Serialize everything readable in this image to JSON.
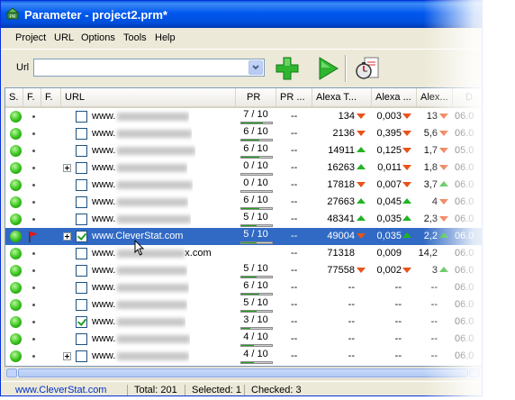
{
  "window": {
    "title": "Parameter - project2.prm*"
  },
  "menu": [
    "Project",
    "URL",
    "Options",
    "Tools",
    "Help"
  ],
  "toolbar": {
    "url_label": "Url",
    "url_value": "",
    "add_tooltip": "add-url",
    "run_tooltip": "run-check",
    "stats_tooltip": "statistics"
  },
  "columns": [
    "S.",
    "F.",
    "F.",
    "URL",
    "PR",
    "PR ...",
    "Alexa T...",
    "Alexa ...",
    "Alex...",
    "D"
  ],
  "rows": [
    {
      "url": "www.",
      "expand": false,
      "checked": false,
      "pr": "7 / 10",
      "prv": 0.7,
      "prdots": "--",
      "alexa": "134",
      "a_dir": "down",
      "alexa2": "0,003",
      "a2_dir": "down",
      "alexa3": "13",
      "a3_dir": "down",
      "date": "06.0"
    },
    {
      "url": "www.",
      "expand": false,
      "checked": false,
      "pr": "6 / 10",
      "prv": 0.6,
      "prdots": "--",
      "alexa": "2136",
      "a_dir": "down",
      "alexa2": "0,395",
      "a2_dir": "down",
      "alexa3": "5,6",
      "a3_dir": "down",
      "date": "06.0"
    },
    {
      "url": "www.",
      "expand": false,
      "checked": false,
      "pr": "6 / 10",
      "prv": 0.6,
      "prdots": "--",
      "alexa": "14911",
      "a_dir": "up",
      "alexa2": "0,125",
      "a2_dir": "down",
      "alexa3": "1,7",
      "a3_dir": "down",
      "date": "05.0"
    },
    {
      "url": "www.",
      "expand": true,
      "checked": false,
      "pr": "0 / 10",
      "prv": 0.0,
      "prdots": "--",
      "alexa": "16263",
      "a_dir": "up",
      "alexa2": "0,011",
      "a2_dir": "down",
      "alexa3": "1,8",
      "a3_dir": "down",
      "date": "06.0"
    },
    {
      "url": "www.",
      "expand": false,
      "checked": false,
      "pr": "0 / 10",
      "prv": 0.0,
      "prdots": "--",
      "alexa": "17818",
      "a_dir": "down",
      "alexa2": "0,007",
      "a2_dir": "down",
      "alexa3": "3,7",
      "a3_dir": "up",
      "date": "06.0"
    },
    {
      "url": "www.",
      "expand": false,
      "checked": false,
      "pr": "6 / 10",
      "prv": 0.6,
      "prdots": "--",
      "alexa": "27663",
      "a_dir": "up",
      "alexa2": "0,045",
      "a2_dir": "up",
      "alexa3": "4",
      "a3_dir": "down",
      "date": "06.0"
    },
    {
      "url": "www.",
      "expand": false,
      "checked": false,
      "pr": "5 / 10",
      "prv": 0.5,
      "prdots": "--",
      "alexa": "48341",
      "a_dir": "up",
      "alexa2": "0,035",
      "a2_dir": "up",
      "alexa3": "2,3",
      "a3_dir": "down",
      "date": "06.0"
    },
    {
      "url": "www.CleverStat.com",
      "expand": true,
      "checked": true,
      "selected": true,
      "flag": true,
      "pr": "5 / 10",
      "prv": 0.5,
      "prdots": "--",
      "alexa": "49004",
      "a_dir": "down",
      "alexa2": "0,035",
      "a2_dir": "up",
      "alexa3": "2,2",
      "a3_dir": "up",
      "date": "06.0"
    },
    {
      "url": "www.",
      "suffix": "x.com",
      "expand": false,
      "checked": false,
      "pr": "",
      "prv": 0.0,
      "prdots": "--",
      "alexa": "71318",
      "a_dir": "",
      "alexa2": "0,009",
      "a2_dir": "",
      "alexa3": "14,2",
      "a3_dir": "",
      "date": "06.0"
    },
    {
      "url": "www.",
      "expand": false,
      "checked": false,
      "pr": "5 / 10",
      "prv": 0.5,
      "prdots": "--",
      "alexa": "77558",
      "a_dir": "down",
      "alexa2": "0,002",
      "a2_dir": "down",
      "alexa3": "3",
      "a3_dir": "up",
      "date": "06.0"
    },
    {
      "url": "www.",
      "expand": false,
      "checked": false,
      "pr": "6 / 10",
      "prv": 0.6,
      "prdots": "--",
      "alexa": "--",
      "a_dir": "",
      "alexa2": "--",
      "a2_dir": "",
      "alexa3": "--",
      "a3_dir": "",
      "date": "06.0"
    },
    {
      "url": "www.",
      "expand": false,
      "checked": false,
      "pr": "5 / 10",
      "prv": 0.5,
      "prdots": "--",
      "alexa": "--",
      "a_dir": "",
      "alexa2": "--",
      "a2_dir": "",
      "alexa3": "--",
      "a3_dir": "",
      "date": "06.0"
    },
    {
      "url": "www.",
      "expand": false,
      "checked": true,
      "pr": "3 / 10",
      "prv": 0.3,
      "prdots": "--",
      "alexa": "--",
      "a_dir": "",
      "alexa2": "--",
      "a2_dir": "",
      "alexa3": "--",
      "a3_dir": "",
      "date": "06.0"
    },
    {
      "url": "www.",
      "expand": false,
      "checked": false,
      "pr": "4 / 10",
      "prv": 0.4,
      "prdots": "--",
      "alexa": "--",
      "a_dir": "",
      "alexa2": "--",
      "a2_dir": "",
      "alexa3": "--",
      "a3_dir": "",
      "date": "06.0"
    },
    {
      "url": "www.",
      "expand": true,
      "checked": false,
      "pr": "4 / 10",
      "prv": 0.4,
      "prdots": "--",
      "alexa": "--",
      "a_dir": "",
      "alexa2": "--",
      "a2_dir": "",
      "alexa3": "--",
      "a3_dir": "",
      "date": "06.0"
    }
  ],
  "status": {
    "link": "www.CleverStat.com",
    "total": "Total: 201",
    "selected": "Selected: 1",
    "checked": "Checked: 3"
  },
  "colors": {
    "titlebar": "#0058ee",
    "selection": "#316ac5",
    "pr_fill": "#1da31d",
    "up": "#22b322",
    "down": "#e8531a"
  }
}
